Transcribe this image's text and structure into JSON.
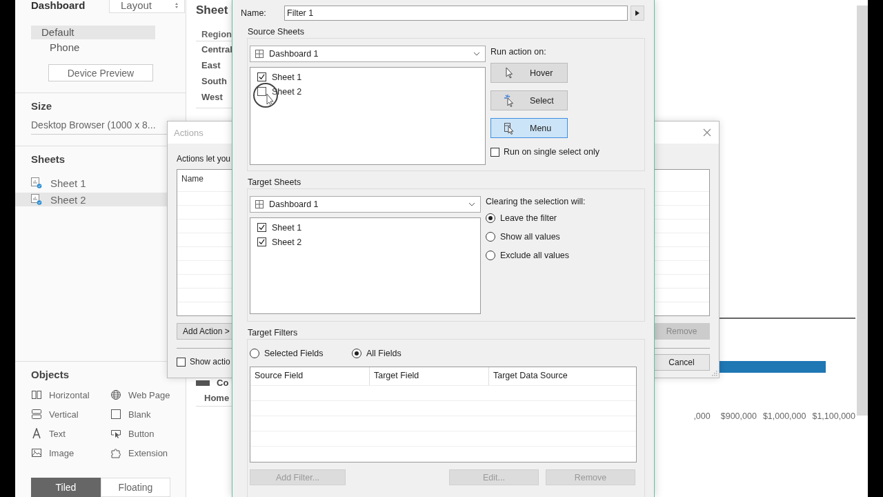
{
  "sidebar": {
    "tabs": [
      {
        "label": "Dashboard",
        "selected": true
      },
      {
        "label": "Layout",
        "selected": false
      }
    ],
    "devices": [
      {
        "label": "Default",
        "selected": true
      },
      {
        "label": "Phone",
        "selected": false
      }
    ],
    "device_preview_button": "Device Preview",
    "size": {
      "heading": "Size",
      "value": "Desktop Browser (1000 x 8..."
    },
    "sheets": {
      "heading": "Sheets",
      "items": [
        {
          "label": "Sheet 1",
          "selected": false
        },
        {
          "label": "Sheet 2",
          "selected": true
        }
      ]
    },
    "objects": {
      "heading": "Objects",
      "items": [
        {
          "label": "Horizontal",
          "kind": "horizontal"
        },
        {
          "label": "Web Page",
          "kind": "web_page"
        },
        {
          "label": "Vertical",
          "kind": "vertical"
        },
        {
          "label": "Blank",
          "kind": "blank"
        },
        {
          "label": "Text",
          "kind": "text"
        },
        {
          "label": "Button",
          "kind": "button"
        },
        {
          "label": "Image",
          "kind": "image"
        },
        {
          "label": "Extension",
          "kind": "extension"
        }
      ]
    },
    "layout_mode": [
      {
        "label": "Tiled",
        "selected": true
      },
      {
        "label": "Floating",
        "selected": false
      }
    ]
  },
  "canvas": {
    "title": "Sheet",
    "table": {
      "header": "Region",
      "rows": [
        "Central",
        "East",
        "South",
        "West"
      ]
    },
    "legend_label": "Co",
    "row_label": "Home",
    "axis_labels": [
      ",000",
      "$900,000",
      "$1,000,000",
      "$1,100,000"
    ]
  },
  "actions_dialog": {
    "title": "Actions",
    "intro": "Actions let you",
    "list_header": "Name",
    "add_button": "Add Action >",
    "remove_button": {
      "label": "Remove",
      "disabled": true
    },
    "cancel_button": "Cancel",
    "show_checkbox": {
      "label": "Show actio",
      "checked": false
    }
  },
  "filter_dialog": {
    "name_label": "Name:",
    "name_value": "Filter 1",
    "source": {
      "heading": "Source Sheets",
      "dropdown": "Dashboard 1",
      "sheets": [
        {
          "label": "Sheet 1",
          "checked": true
        },
        {
          "label": "Sheet 2",
          "checked": false
        }
      ],
      "run_label": "Run action on:",
      "run_options": [
        {
          "label": "Hover",
          "kind": "hover",
          "selected": false
        },
        {
          "label": "Select",
          "kind": "select",
          "selected": false
        },
        {
          "label": "Menu",
          "kind": "menu",
          "selected": true
        }
      ],
      "single_select": {
        "label": "Run on single select only",
        "checked": false
      }
    },
    "target": {
      "heading": "Target Sheets",
      "dropdown": "Dashboard 1",
      "sheets": [
        {
          "label": "Sheet 1",
          "checked": true
        },
        {
          "label": "Sheet 2",
          "checked": true
        }
      ],
      "clear_label": "Clearing the selection will:",
      "clear_options": [
        {
          "label": "Leave the filter",
          "selected": true
        },
        {
          "label": "Show all values",
          "selected": false
        },
        {
          "label": "Exclude all values",
          "selected": false
        }
      ]
    },
    "filters": {
      "heading": "Target Filters",
      "modes": [
        {
          "label": "Selected Fields",
          "selected": false
        },
        {
          "label": "All Fields",
          "selected": true
        }
      ],
      "columns": [
        "Source Field",
        "Target Field",
        "Target Data Source"
      ],
      "buttons": [
        {
          "label": "Add Filter...",
          "disabled": true
        },
        {
          "label": "Edit...",
          "disabled": true
        },
        {
          "label": "Remove",
          "disabled": true
        }
      ]
    }
  }
}
